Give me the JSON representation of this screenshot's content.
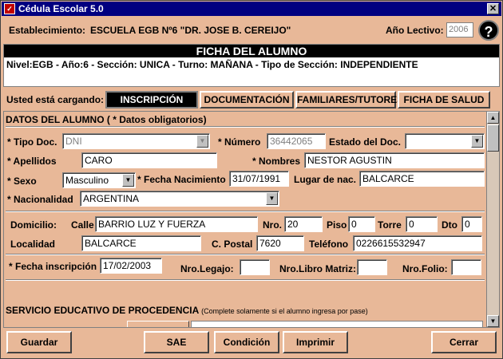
{
  "window": {
    "title": "Cédula Escolar 5.0",
    "icon": "app-icon",
    "close_icon": "close-icon"
  },
  "header": {
    "estab_label": "Establecimiento:",
    "estab_value": "ESCUELA EGB Nº6 \"DR. JOSE B. CEREIJO\"",
    "anio_label": "Año Lectivo:",
    "anio_value": "2006",
    "help_label": "?"
  },
  "ficha": {
    "title": "FICHA DEL ALUMNO",
    "line": "Nivel:EGB - Año:6 - Sección: UNICA - Turno: MAÑANA - Tipo de Sección: INDEPENDIENTE"
  },
  "tabs": {
    "label": "Usted está cargando:",
    "items": [
      "INSCRIPCIÓN",
      "DOCUMENTACIÓN",
      "FAMILIARES/TUTORES",
      "FICHA DE SALUD"
    ],
    "active": "INSCRIPCIÓN"
  },
  "form": {
    "section_title": "DATOS DEL ALUMNO ( *  Datos obligatorios)",
    "tipo_doc_label": "* Tipo Doc.",
    "tipo_doc_value": "DNI",
    "numero_label": "* Número",
    "numero_value": "36442065",
    "estado_doc_label": "Estado del Doc.",
    "estado_doc_value": "",
    "apellidos_label": "* Apellidos",
    "apellidos_value": "CARO",
    "nombres_label": "* Nombres",
    "nombres_value": "NESTOR AGUSTIN",
    "sexo_label": "* Sexo",
    "sexo_value": "Masculino",
    "fecha_nac_label": "* Fecha Nacimiento",
    "fecha_nac_value": "31/07/1991",
    "lugar_nac_label": "Lugar de nac.",
    "lugar_nac_value": "BALCARCE",
    "nacionalidad_label": "* Nacionalidad",
    "nacionalidad_value": "ARGENTINA",
    "domicilio_label": "Domicilio:",
    "calle_label": "Calle",
    "calle_value": "BARRIO LUZ Y FUERZA",
    "nro_label": "Nro.",
    "nro_value": "20",
    "piso_label": "Piso",
    "piso_value": "0",
    "torre_label": "Torre",
    "torre_value": "0",
    "dto_label": "Dto",
    "dto_value": "0",
    "localidad_label": "Localidad",
    "localidad_value": "BALCARCE",
    "cpostal_label": "C. Postal",
    "cpostal_value": "7620",
    "telefono_label": "Teléfono",
    "telefono_value": "0226615532947",
    "fecha_insc_label": "* Fecha inscripción",
    "fecha_insc_value": "17/02/2003",
    "legajo_label": "Nro.Legajo:",
    "legajo_value": "",
    "libro_label": "Nro.Libro Matriz:",
    "libro_value": "",
    "folio_label": "Nro.Folio:",
    "folio_value": "",
    "servicio_title": "SERVICIO EDUCATIVO DE PROCEDENCIA",
    "servicio_note": "(Complete solamente si el alumno ingresa por pase)"
  },
  "buttons": {
    "guardar": "Guardar",
    "sae": "SAE",
    "condicion": "Condición",
    "imprimir": "Imprimir",
    "cerrar": "Cerrar"
  }
}
